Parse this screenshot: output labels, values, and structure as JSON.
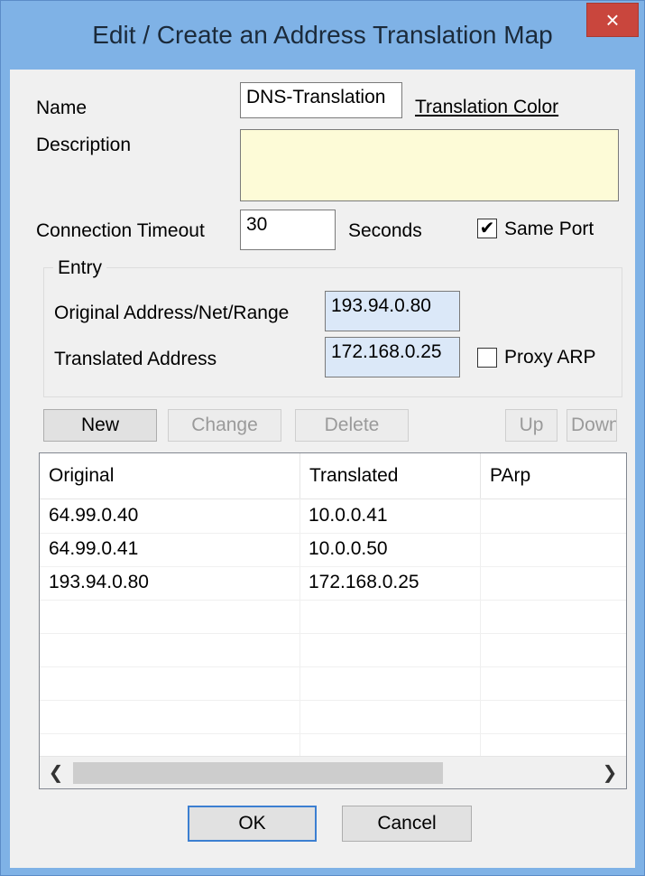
{
  "dialog": {
    "title": "Edit / Create an Address Translation Map",
    "close_glyph": "×"
  },
  "form": {
    "name_label": "Name",
    "name_value": "DNS-Translation",
    "color_link": "Translation Color",
    "description_label": "Description",
    "description_value": "",
    "timeout_label": "Connection Timeout",
    "timeout_value": "30",
    "timeout_unit": "Seconds",
    "same_port_label": "Same Port",
    "same_port_checked": true
  },
  "entry": {
    "legend": "Entry",
    "original_label": "Original Address/Net/Range",
    "original_value": "193.94.0.80",
    "translated_label": "Translated Address",
    "translated_value": "172.168.0.25",
    "proxy_arp_label": "Proxy ARP",
    "proxy_arp_checked": false
  },
  "buttons": {
    "new": "New",
    "change": "Change",
    "delete": "Delete",
    "up": "Up",
    "down": "Down",
    "ok": "OK",
    "cancel": "Cancel"
  },
  "table": {
    "columns": [
      "Original",
      "Translated",
      "PArp"
    ],
    "rows": [
      [
        "64.99.0.40",
        "10.0.0.41",
        ""
      ],
      [
        "64.99.0.41",
        "10.0.0.50",
        ""
      ],
      [
        "193.94.0.80",
        "172.168.0.25",
        ""
      ]
    ]
  },
  "icons": {
    "close": "close-icon",
    "check": "checkmark-icon",
    "scroll_left": "chevron-left-icon",
    "scroll_right": "chevron-right-icon"
  },
  "colors": {
    "title_bar": "#7fb2e6",
    "close_button": "#c9463d",
    "address_field": "#dbe8f8",
    "description_field": "#fdfbd7",
    "default_button_border": "#3c7fd1"
  }
}
